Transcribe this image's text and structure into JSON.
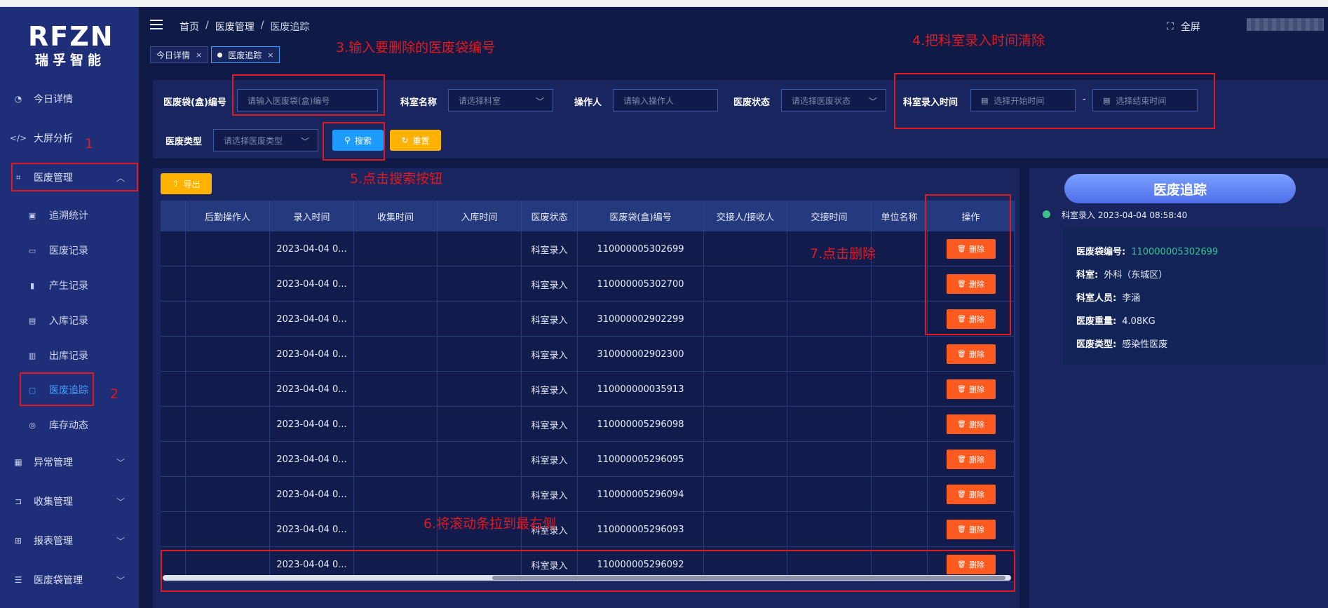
{
  "logo": {
    "brand": "RFZN",
    "name": "瑞孚智能"
  },
  "sidebar": {
    "items": [
      {
        "label": "今日详情"
      },
      {
        "label": "大屏分析"
      },
      {
        "label": "医废管理"
      },
      {
        "label": "异常管理"
      },
      {
        "label": "收集管理"
      },
      {
        "label": "报表管理"
      },
      {
        "label": "医废袋管理"
      }
    ],
    "sub_items": [
      {
        "label": "追溯统计"
      },
      {
        "label": "医废记录"
      },
      {
        "label": "产生记录"
      },
      {
        "label": "入库记录"
      },
      {
        "label": "出库记录"
      },
      {
        "label": "医废追踪"
      },
      {
        "label": "库存动态"
      }
    ]
  },
  "header": {
    "breadcrumb": [
      "首页",
      "医废管理",
      "医废追踪"
    ],
    "fullscreen_label": "全屏",
    "tabs": [
      {
        "label": "今日详情"
      },
      {
        "label": "医废追踪"
      }
    ]
  },
  "filter": {
    "bag_no_label": "医废袋(盒)编号",
    "bag_no_placeholder": "请输入医废袋(盒)编号",
    "dept_label": "科室名称",
    "dept_placeholder": "请选择科室",
    "operator_label": "操作人",
    "operator_placeholder": "请输入操作人",
    "status_label": "医废状态",
    "status_placeholder": "请选择医废状态",
    "time_label": "科室录入时间",
    "start_placeholder": "选择开始时间",
    "end_placeholder": "选择结束时间",
    "range_sep": "-",
    "type_label": "医废类型",
    "type_placeholder": "请选择医废类型",
    "search_label": "搜索",
    "reset_label": "重置"
  },
  "toolbar": {
    "export_label": "导出"
  },
  "table": {
    "headers": [
      "后勤操作人",
      "录入时间",
      "收集时间",
      "入库时间",
      "医废状态",
      "医废袋(盒)编号",
      "交接人/接收人",
      "交接时间",
      "单位名称",
      "操作"
    ],
    "delete_label": "删除",
    "rows": [
      {
        "time": "2023-04-04 0...",
        "status": "科室录入",
        "code": "110000005302699"
      },
      {
        "time": "2023-04-04 0...",
        "status": "科室录入",
        "code": "110000005302700"
      },
      {
        "time": "2023-04-04 0...",
        "status": "科室录入",
        "code": "310000002902299"
      },
      {
        "time": "2023-04-04 0...",
        "status": "科室录入",
        "code": "310000002902300"
      },
      {
        "time": "2023-04-04 0...",
        "status": "科室录入",
        "code": "110000000035913"
      },
      {
        "time": "2023-04-04 0...",
        "status": "科室录入",
        "code": "110000005296098"
      },
      {
        "time": "2023-04-04 0...",
        "status": "科室录入",
        "code": "110000005296095"
      },
      {
        "time": "2023-04-04 0...",
        "status": "科室录入",
        "code": "110000005296094"
      },
      {
        "time": "2023-04-04 0...",
        "status": "科室录入",
        "code": "110000005296093"
      },
      {
        "time": "2023-04-04 0...",
        "status": "科室录入",
        "code": "110000005296092"
      }
    ]
  },
  "trace": {
    "title": "医废追踪",
    "event": "科室录入 2023-04-04 08:58:40",
    "details": [
      {
        "key": "医废袋编号:",
        "value": "110000005302699"
      },
      {
        "key": "科室:",
        "value": "外科（东城区）"
      },
      {
        "key": "科室人员:",
        "value": "李涵"
      },
      {
        "key": "医废重量:",
        "value": "4.08KG"
      },
      {
        "key": "医废类型:",
        "value": "感染性医废"
      }
    ]
  },
  "annotations": {
    "a1": "1",
    "a2": "2",
    "a3": "3.输入要删除的医废袋编号",
    "a4": "4.把科室录入时间清除",
    "a5": "5.点击搜索按钮",
    "a6": "6.将滚动条拉到最右侧",
    "a7": "7.点击删除"
  },
  "colors": {
    "accent": "#3ea2ff",
    "delete": "#ff5a1f",
    "search": "#1e9bff",
    "reset": "#ffb200",
    "annotation": "#e2191f"
  }
}
